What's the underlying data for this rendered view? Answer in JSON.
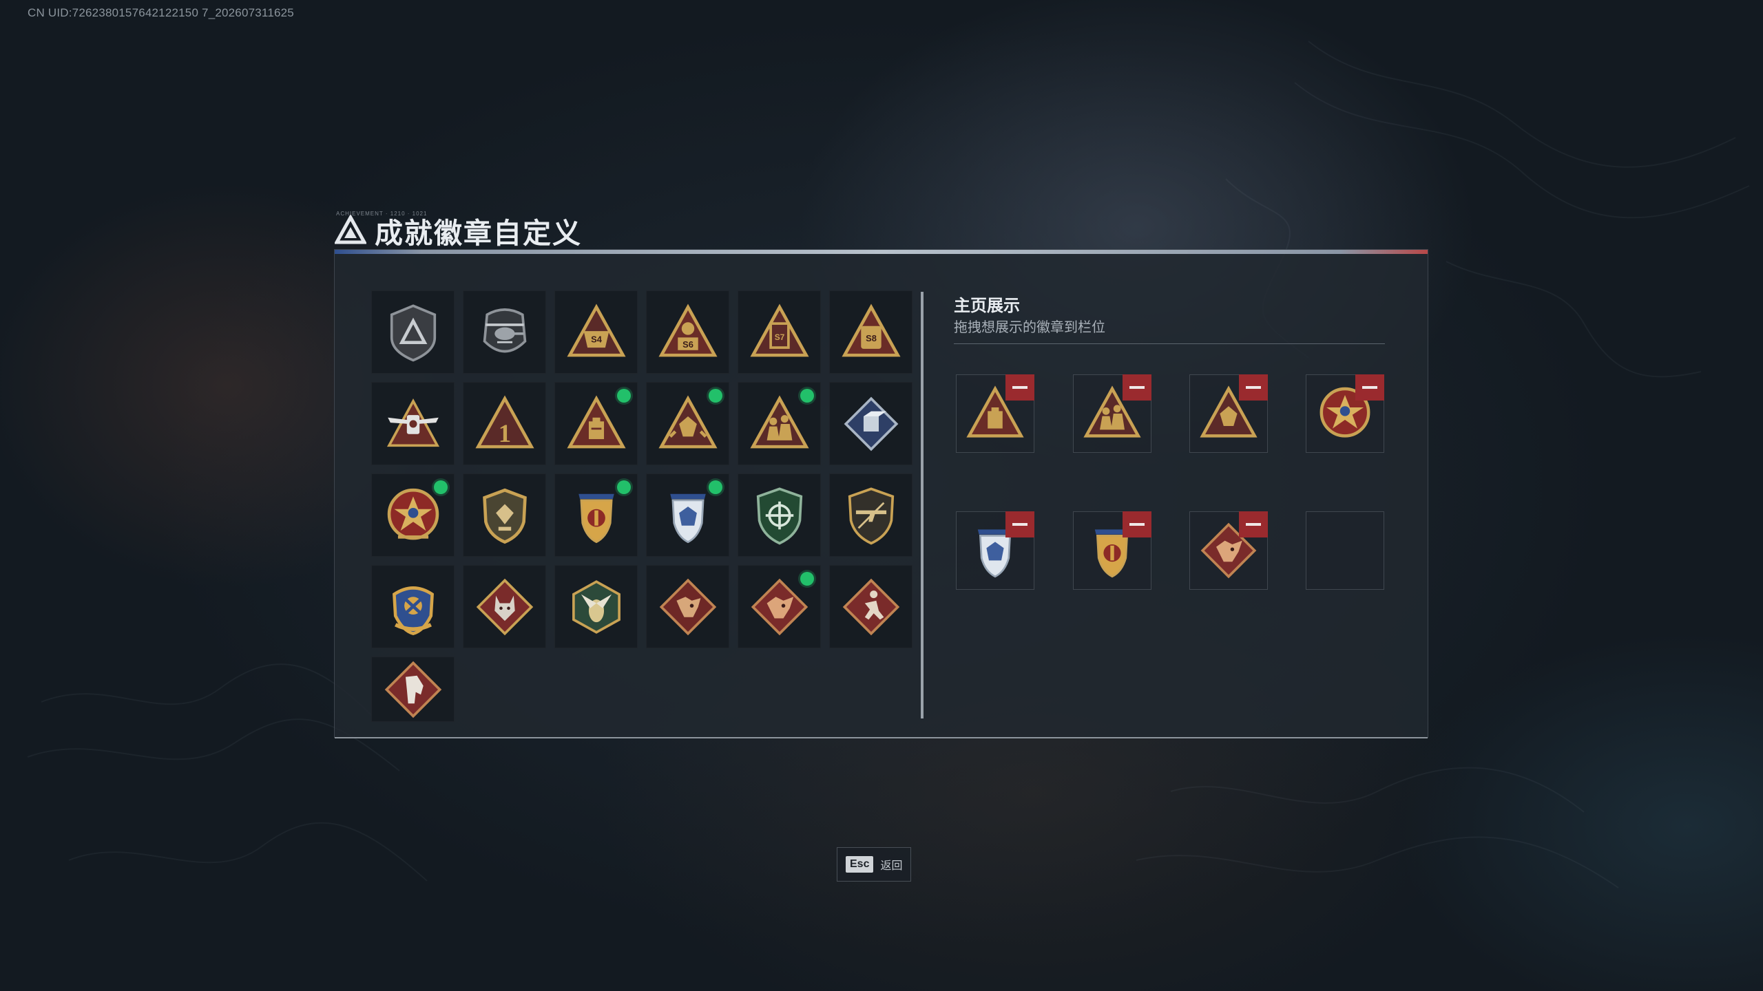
{
  "uid_text": "CN UID:7262380157642122150 7_202607311625",
  "header": {
    "title": "成就徽章自定义",
    "tiny_caption": "ACHIEVEMENT · 1210 · 1021"
  },
  "badges": [
    {
      "icon": "grey-shield-triangle-badge",
      "new": false
    },
    {
      "icon": "helicopter-shield-badge",
      "new": false
    },
    {
      "icon": "s4-triangle-badge",
      "text": "S4",
      "new": false
    },
    {
      "icon": "s6-triangle-badge",
      "text": "S6",
      "new": false
    },
    {
      "icon": "s7-triangle-badge",
      "text": "S7",
      "new": false
    },
    {
      "icon": "s8-triangle-badge",
      "text": "S8",
      "new": false
    },
    {
      "icon": "winged-triangle-badge",
      "new": false
    },
    {
      "icon": "number-one-triangle-badge",
      "text": "1",
      "new": false
    },
    {
      "icon": "supply-crate-triangle-badge",
      "new": true
    },
    {
      "icon": "gem-triangle-badge",
      "new": true
    },
    {
      "icon": "squad-triangle-badge",
      "new": true
    },
    {
      "icon": "steel-diamond-badge",
      "new": false
    },
    {
      "icon": "gold-star-medal-badge",
      "new": true
    },
    {
      "icon": "gold-crest-shield-badge",
      "new": false
    },
    {
      "icon": "red-gold-shield-badge",
      "new": true
    },
    {
      "icon": "blue-silver-shield-badge",
      "new": true
    },
    {
      "icon": "green-crosshair-shield-badge",
      "new": false
    },
    {
      "icon": "rifle-shield-badge",
      "new": false
    },
    {
      "icon": "blue-gold-crest-badge",
      "new": false
    },
    {
      "icon": "wolf-diamond-badge",
      "new": false
    },
    {
      "icon": "green-hex-bee-badge",
      "new": false
    },
    {
      "icon": "dragon-diamond-badge",
      "new": false
    },
    {
      "icon": "red-dragon-diamond-badge",
      "new": true
    },
    {
      "icon": "runner-diamond-badge",
      "new": false
    },
    {
      "icon": "horse-diamond-badge",
      "new": false
    }
  ],
  "showcase": {
    "title": "主页展示",
    "subtitle": "拖拽想展示的徽章到栏位",
    "slots": [
      {
        "icon": "supply-crate-triangle-badge",
        "filled": true
      },
      {
        "icon": "squad-triangle-badge",
        "filled": true
      },
      {
        "icon": "gem-triangle-badge",
        "filled": true
      },
      {
        "icon": "gold-star-medal-badge",
        "filled": true
      },
      {
        "icon": "blue-silver-shield-badge",
        "filled": true
      },
      {
        "icon": "red-gold-shield-badge",
        "filled": true
      },
      {
        "icon": "red-dragon-diamond-badge",
        "filled": true
      },
      {
        "icon": "empty-slot",
        "filled": false
      }
    ]
  },
  "footer": {
    "esc_key": "Esc",
    "esc_label": "返回"
  },
  "colors": {
    "gold": "#c9a254",
    "dark_red": "#7a2b2a",
    "steel_blue": "#3e5f9e",
    "green_dot": "#22c06a",
    "remove_red": "#9a2a2e"
  }
}
